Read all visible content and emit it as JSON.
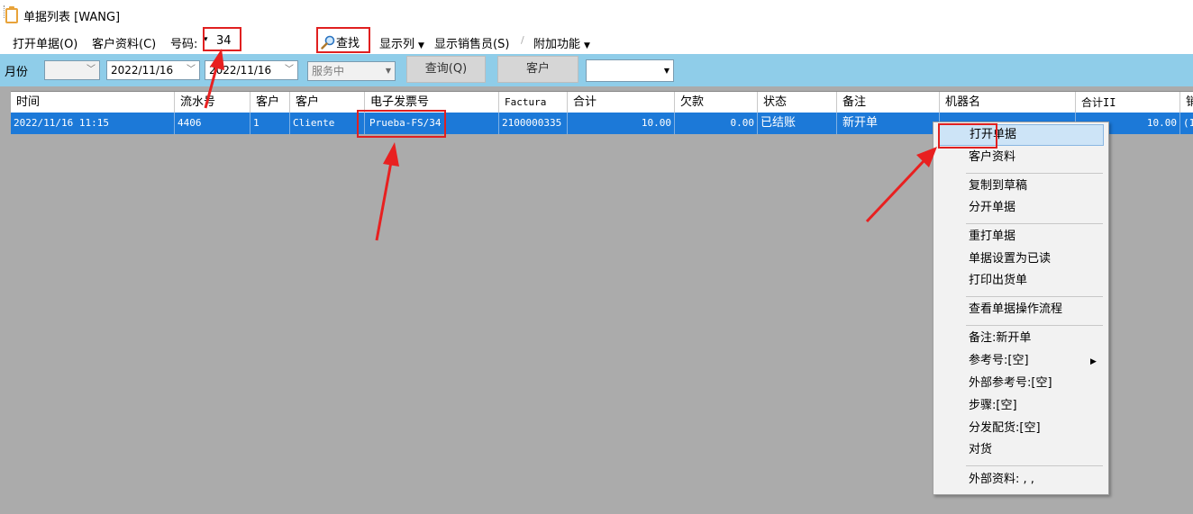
{
  "window": {
    "title": "单据列表  [WANG]"
  },
  "toolbar": {
    "open_doc": "打开单据(O)",
    "customer_info": "客户资料(C)",
    "number_label": "号码:",
    "number_value": "34",
    "search": "查找",
    "show_columns": "显示列",
    "show_salesperson": "显示销售员(S)",
    "extra_functions": "附加功能"
  },
  "filter": {
    "month_label": "月份",
    "date_from": "2022/11/16",
    "date_to": "2022/11/16",
    "status_value": "服务中",
    "query_button": "查询(Q)",
    "customer_button": "客户"
  },
  "table": {
    "headers": [
      "时间",
      "流水号",
      "客户",
      "客户",
      "电子发票号",
      "Factura",
      "合计",
      "欠款",
      "状态",
      "备注",
      "机器名",
      "合计II",
      "销"
    ],
    "rows": [
      {
        "time": "2022/11/16 11:15",
        "serial": "4406",
        "customer_no": "1",
        "customer": "Cliente",
        "einvoice": "Prueba-FS/34",
        "factura": "2100000335",
        "total": "10.00",
        "debt": "0.00",
        "status": "已结账",
        "note": "新开单",
        "machine": "",
        "total2": "10.00",
        "extra": "(1"
      }
    ]
  },
  "context_menu": {
    "items": [
      "打开单据",
      "客户资料",
      "复制到草稿",
      "分开单据",
      "重打单据",
      "单据设置为已读",
      "打印出货单",
      "查看单据操作流程",
      "备注:新开单",
      "参考号:[空]",
      "外部参考号:[空]",
      "步骤:[空]",
      "分发配货:[空]",
      "对货",
      "外部资料: , ,"
    ]
  },
  "colors": {
    "selection": "#1c79d8",
    "filter_bar": "#8fcde9",
    "annotation": "#e02020"
  }
}
